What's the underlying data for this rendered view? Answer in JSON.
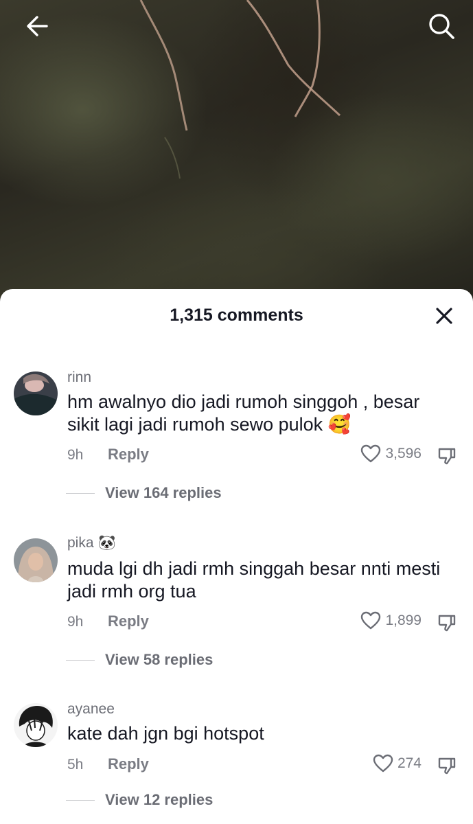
{
  "sheet": {
    "title": "1,315 comments"
  },
  "icons": {
    "back": "arrow-left-icon",
    "search": "search-icon",
    "close": "close-icon",
    "like": "heart-outline-icon",
    "dislike": "thumbs-down-icon"
  },
  "comments": [
    {
      "username": "rinn",
      "text": "hm awalnyo dio jadi rumoh singgoh , besar sikit lagi jadi rumoh sewo pulok 🥰",
      "time": "9h",
      "reply_label": "Reply",
      "likes": "3,596",
      "replies_label": "View 164 replies"
    },
    {
      "username": "pika",
      "username_emoji": "🐼",
      "text": "muda lgi dh jadi rmh singgah besar nnti mesti jadi rmh org tua",
      "time": "9h",
      "reply_label": "Reply",
      "likes": "1,899",
      "replies_label": "View 58 replies"
    },
    {
      "username": "ayanee",
      "text": "kate dah jgn bgi hotspot",
      "time": "5h",
      "reply_label": "Reply",
      "likes": "274",
      "replies_label": "View 12 replies"
    }
  ],
  "colors": {
    "text_primary": "#161823",
    "text_secondary": "#7a7c84",
    "sheet_bg": "#ffffff"
  }
}
